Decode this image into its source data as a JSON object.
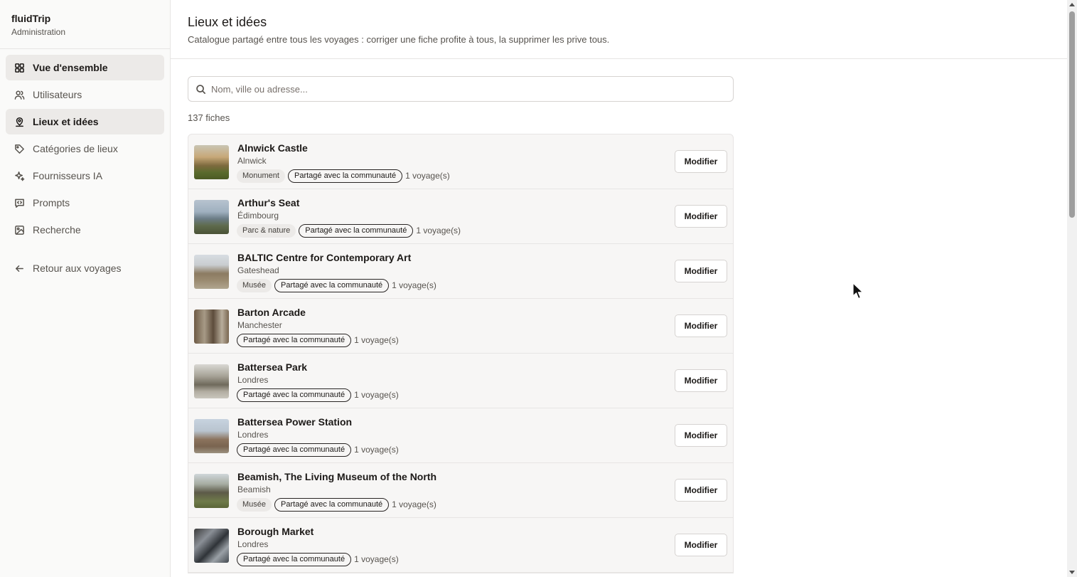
{
  "brand": {
    "name": "fluidTrip",
    "subtitle": "Administration"
  },
  "sidebar": {
    "items": [
      {
        "label": "Vue d'ensemble",
        "icon": "grid-icon",
        "active": true
      },
      {
        "label": "Utilisateurs",
        "icon": "users-icon",
        "active": false
      },
      {
        "label": "Lieux et idées",
        "icon": "map-pin-icon",
        "active": true
      },
      {
        "label": "Catégories de lieux",
        "icon": "tag-icon",
        "active": false
      },
      {
        "label": "Fournisseurs IA",
        "icon": "sparkles-icon",
        "active": false
      },
      {
        "label": "Prompts",
        "icon": "code-message-icon",
        "active": false
      },
      {
        "label": "Recherche",
        "icon": "image-icon",
        "active": false
      }
    ],
    "back_label": "Retour aux voyages"
  },
  "header": {
    "title": "Lieux et idées",
    "subtitle": "Catalogue partagé entre tous les voyages : corriger une fiche profite à tous, la supprimer les prive tous."
  },
  "search": {
    "placeholder": "Nom, ville ou adresse...",
    "value": ""
  },
  "count_label": "137 fiches",
  "shared_label": "Partagé avec la communauté",
  "edit_label": "Modifier",
  "places": [
    {
      "name": "Alnwick Castle",
      "city": "Alnwick",
      "category": "Monument",
      "trips": "1 voyage(s)"
    },
    {
      "name": "Arthur's Seat",
      "city": "Édimbourg",
      "category": "Parc & nature",
      "trips": "1 voyage(s)"
    },
    {
      "name": "BALTIC Centre for Contemporary Art",
      "city": "Gateshead",
      "category": "Musée",
      "trips": "1 voyage(s)"
    },
    {
      "name": "Barton Arcade",
      "city": "Manchester",
      "category": "",
      "trips": "1 voyage(s)"
    },
    {
      "name": "Battersea Park",
      "city": "Londres",
      "category": "",
      "trips": "1 voyage(s)"
    },
    {
      "name": "Battersea Power Station",
      "city": "Londres",
      "category": "",
      "trips": "1 voyage(s)"
    },
    {
      "name": "Beamish, The Living Museum of the North",
      "city": "Beamish",
      "category": "Musée",
      "trips": "1 voyage(s)"
    },
    {
      "name": "Borough Market",
      "city": "Londres",
      "category": "",
      "trips": "1 voyage(s)"
    }
  ],
  "colors": {
    "accent": "#1c1917",
    "active_bg": "#eceae8",
    "row_bg": "#f7f6f5",
    "border": "#e7e5e4"
  }
}
